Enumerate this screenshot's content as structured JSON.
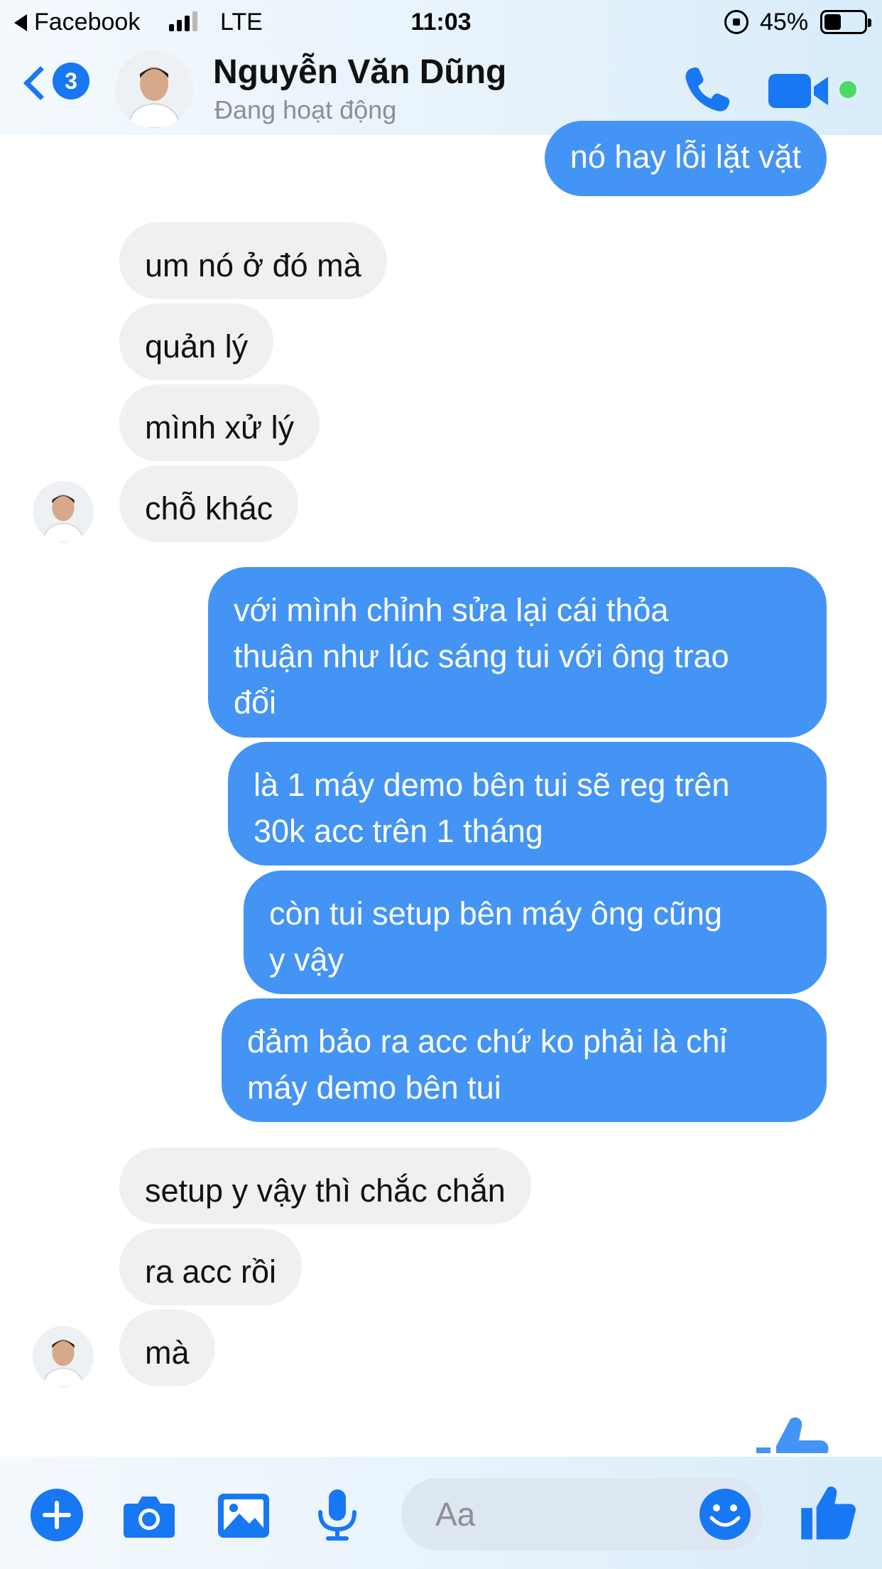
{
  "status_bar": {
    "back_app": "Facebook",
    "network": "LTE",
    "time": "11:03",
    "battery": "45%"
  },
  "header": {
    "unread_count": "3",
    "name": "Nguyễn Văn Dũng",
    "status": "Đang hoạt động"
  },
  "messages": [
    {
      "dir": "out",
      "text": "nó hay lỗi lặt vặt"
    },
    {
      "dir": "in",
      "text": "um nó ở đó mà"
    },
    {
      "dir": "in",
      "text": "quản lý"
    },
    {
      "dir": "in",
      "text": "mình xử lý"
    },
    {
      "dir": "in",
      "text": "chỗ khác"
    },
    {
      "dir": "out",
      "lines": [
        "với mình chỉnh sửa lại cái thỏa",
        "thuận như lúc sáng tui với ông trao",
        "đổi"
      ]
    },
    {
      "dir": "out",
      "lines": [
        "là 1 máy demo bên tui sẽ reg trên",
        "30k acc trên 1 tháng"
      ]
    },
    {
      "dir": "out",
      "lines": [
        "còn tui setup bên máy ông cũng",
        "y vậy"
      ]
    },
    {
      "dir": "out",
      "lines": [
        "đảm bảo ra acc chứ ko phải là chỉ",
        "máy demo bên tui"
      ]
    },
    {
      "dir": "in",
      "text": "setup y vậy thì chắc chắn"
    },
    {
      "dir": "in",
      "text": "ra acc rồi"
    },
    {
      "dir": "in",
      "text": "mà"
    }
  ],
  "composer": {
    "placeholder": "Aa"
  },
  "colors": {
    "accent": "#1877f2",
    "outgoing_bubble": "#4494f5",
    "incoming_bubble": "#f0f0f0",
    "online": "#4cd964"
  },
  "icons": {
    "header": [
      "back-chevron-icon",
      "phone-icon",
      "video-camera-icon"
    ],
    "composer": [
      "plus-icon",
      "camera-icon",
      "image-icon",
      "microphone-icon",
      "emoji-icon",
      "thumbs-up-icon"
    ]
  }
}
